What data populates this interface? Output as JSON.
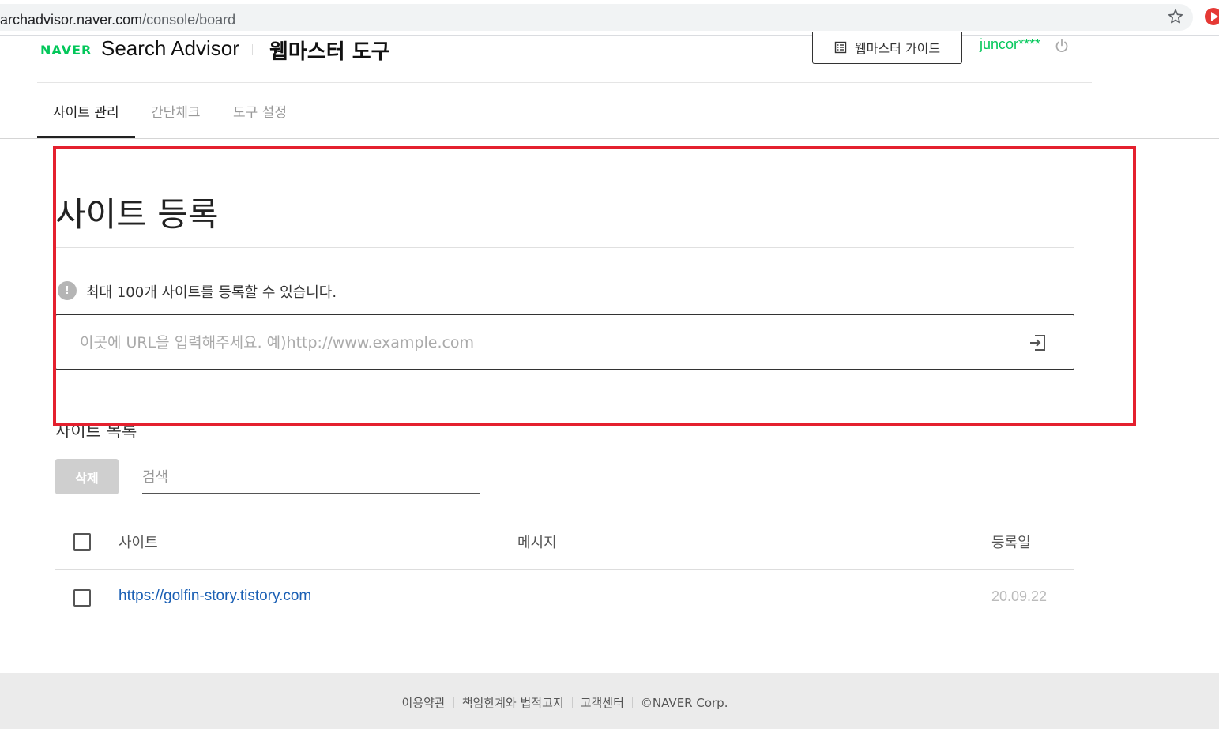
{
  "browser": {
    "url_host": "archadvisor.naver.com",
    "url_path": "/console/board"
  },
  "header": {
    "logo": "NAVER",
    "brand": "Search Advisor",
    "subtitle": "웹마스터 도구",
    "guide_label": "웹마스터 가이드",
    "user": "juncor****"
  },
  "tabs": [
    {
      "label": "사이트 관리",
      "active": true
    },
    {
      "label": "간단체크",
      "active": false
    },
    {
      "label": "도구 설정",
      "active": false
    }
  ],
  "register": {
    "title": "사이트 등록",
    "info": "최대 100개 사이트를 등록할 수 있습니다.",
    "placeholder": "이곳에 URL을 입력해주세요. 예)http://www.example.com"
  },
  "site_list": {
    "title": "사이트 목록",
    "delete_label": "삭제",
    "search_placeholder": "검색",
    "columns": {
      "site": "사이트",
      "message": "메시지",
      "date": "등록일"
    },
    "rows": [
      {
        "site": "https://golfin-story.tistory.com",
        "message": "",
        "date": "20.09.22"
      }
    ]
  },
  "footer": {
    "links": [
      "이용약관",
      "책임한계와 법적고지",
      "고객센터"
    ],
    "copyright": "©NAVER Corp."
  },
  "colors": {
    "naver_green": "#03c75a",
    "highlight_red": "#e4202e",
    "link_blue": "#1a5fb4"
  }
}
